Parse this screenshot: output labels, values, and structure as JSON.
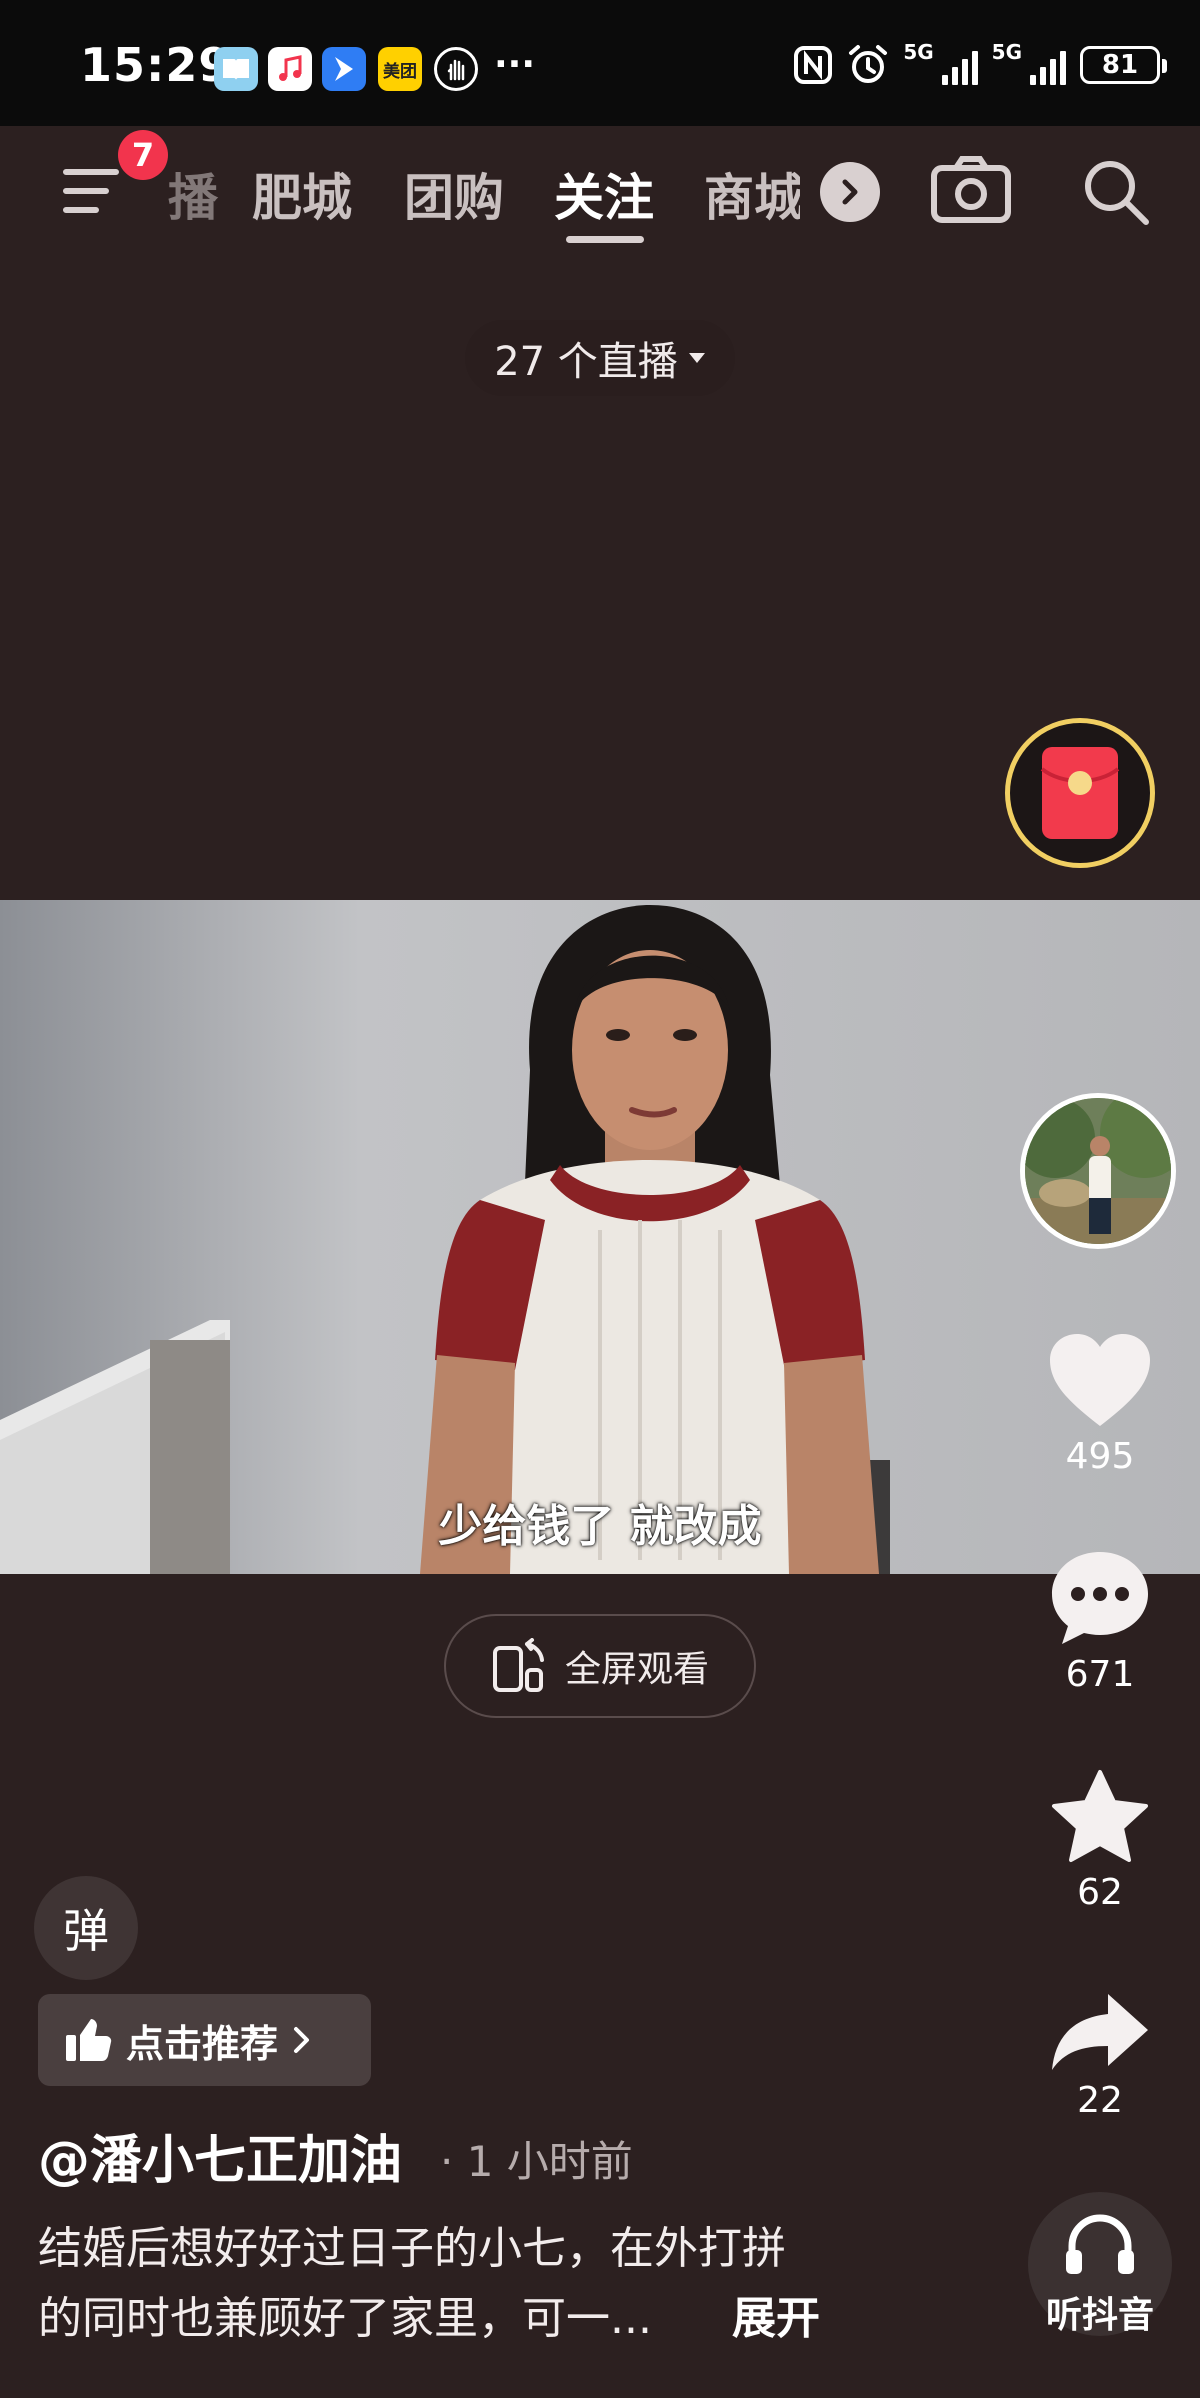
{
  "status_bar": {
    "time": "15:29",
    "app_icons": [
      "book-app-icon",
      "music-app-icon",
      "navigation-app-icon",
      "meituan-app-icon",
      "gesture-app-icon"
    ],
    "meituan_label": "美团",
    "more": "···",
    "network_1": "5G",
    "network_2": "5G",
    "battery": "81"
  },
  "nav": {
    "menu_badge": "7",
    "tabs": [
      "播",
      "肥城",
      "团购",
      "关注",
      "商城"
    ],
    "active_tab": "关注"
  },
  "live": {
    "label": "27 个直播"
  },
  "video": {
    "subtitle": "少给钱了 就改成"
  },
  "fullscreen": {
    "label": "全屏观看"
  },
  "actions": {
    "likes": "495",
    "comments": "671",
    "favorites": "62",
    "shares": "22"
  },
  "danmu": {
    "label": "弹"
  },
  "recommend": {
    "label": "点击推荐"
  },
  "post": {
    "author": "@潘小七正加油",
    "time_ago": "· 1 小时前",
    "description_line1": "结婚后想好好过日子的小七，在外打拼",
    "description_line2": "的同时也兼顾好了家里，可一...",
    "expand": "展开"
  },
  "listen": {
    "label": "听抖音"
  },
  "colors": {
    "background": "#2c2020",
    "badge": "#f2344d",
    "redpacket_ring": "#f1cf62"
  }
}
